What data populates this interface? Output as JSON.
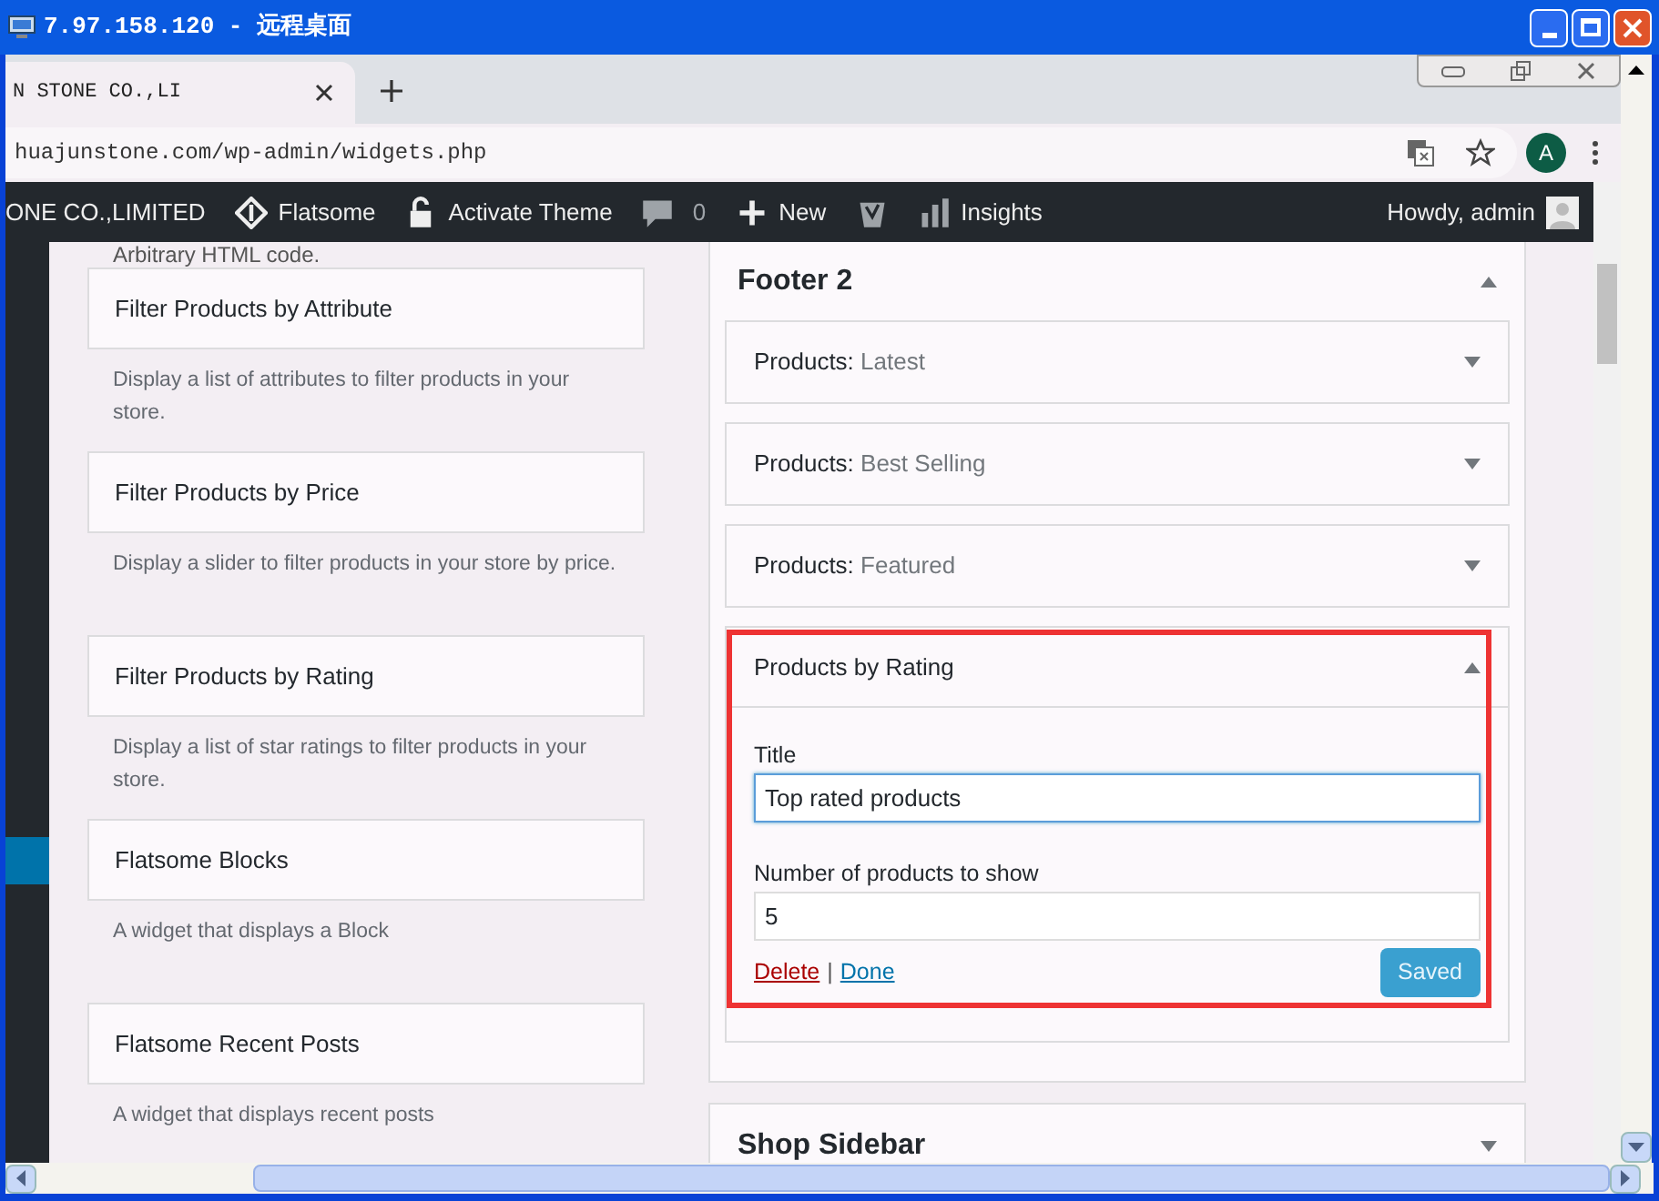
{
  "window": {
    "title": "7.97.158.120 - 远程桌面"
  },
  "browser": {
    "tab_title": "N STONE CO.,LI",
    "url": "huajunstone.com/wp-admin/widgets.php",
    "profile_initial": "A"
  },
  "admin_bar": {
    "items": [
      {
        "kind": "site",
        "label": "ONE CO.,LIMITED"
      },
      {
        "kind": "flatsome",
        "label": "Flatsome"
      },
      {
        "kind": "lock",
        "label": "Activate Theme"
      },
      {
        "kind": "comments",
        "label": "0"
      },
      {
        "kind": "new",
        "label": "New"
      },
      {
        "kind": "yoast"
      },
      {
        "kind": "insights",
        "label": "Insights"
      }
    ],
    "account": "Howdy, admin"
  },
  "available_widgets": {
    "top_description": "Arbitrary HTML code.",
    "widgets": [
      {
        "title": "Filter Products by Attribute",
        "description": "Display a list of attributes to filter products in your store."
      },
      {
        "title": "Filter Products by Price",
        "description": "Display a slider to filter products in your store by price."
      },
      {
        "title": "Filter Products by Rating",
        "description": "Display a list of star ratings to filter products in your store."
      },
      {
        "title": "Flatsome Blocks",
        "description": "A widget that displays a Block"
      },
      {
        "title": "Flatsome Recent Posts",
        "description": "A widget that displays recent posts"
      }
    ]
  },
  "sidebars": [
    {
      "title": "Footer 2",
      "expanded": true,
      "widgets": [
        {
          "prefix": "Products:",
          "name": "Latest",
          "expanded": false
        },
        {
          "prefix": "Products:",
          "name": "Best Selling",
          "expanded": false
        },
        {
          "prefix": "Products:",
          "name": "Featured",
          "expanded": false
        },
        {
          "name": "Products by Rating",
          "expanded": true,
          "fields": [
            {
              "label": "Title",
              "value": "Top rated products",
              "focused": true
            },
            {
              "label": "Number of products to show",
              "value": "5",
              "focused": false
            }
          ],
          "delete": "Delete",
          "separator": "|",
          "done": "Done",
          "save": "Saved",
          "save_disabled": true
        }
      ]
    },
    {
      "title": "Shop Sidebar",
      "expanded": false
    }
  ]
}
